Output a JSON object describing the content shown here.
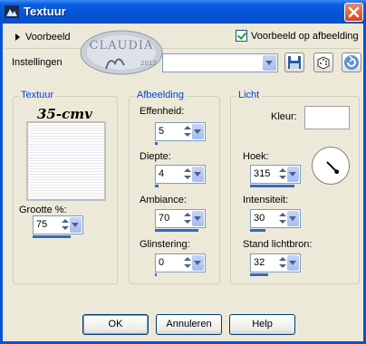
{
  "window": {
    "title": "Textuur",
    "close_icon": "close-icon"
  },
  "preview": {
    "label": "Voorbeeld",
    "checkbox_label": "Voorbeeld op afbeelding",
    "checked": true
  },
  "logo": {
    "text": "CLAUDIA",
    "year": "2012"
  },
  "settings": {
    "label": "Instellingen",
    "value": "",
    "icons": [
      "save-icon",
      "randomize-dice-icon",
      "reset-icon"
    ]
  },
  "texture": {
    "group_title": "Textuur",
    "name": "35-cmv",
    "size_label": "Grootte %:",
    "size_value": "75",
    "size_fraction": 0.75
  },
  "image": {
    "group_title": "Afbeelding",
    "smoothness_label": "Effenheid:",
    "smoothness_value": "5",
    "smoothness_fraction": 0.05,
    "depth_label": "Diepte:",
    "depth_value": "4",
    "depth_fraction": 0.08,
    "ambience_label": "Ambiance:",
    "ambience_value": "70",
    "ambience_fraction": 0.85,
    "shine_label": "Glinstering:",
    "shine_value": "0",
    "shine_fraction": 0
  },
  "light": {
    "group_title": "Licht",
    "color_label": "Kleur:",
    "color": "#FFFFFF",
    "angle_label": "Hoek:",
    "angle_value": "315",
    "angle_fraction": 0.875,
    "intensity_label": "Intensiteit:",
    "intensity_value": "30",
    "intensity_fraction": 0.3,
    "elevation_label": "Stand lichtbron:",
    "elevation_value": "32",
    "elevation_fraction": 0.36
  },
  "buttons": {
    "ok": "OK",
    "cancel": "Annuleren",
    "help": "Help"
  },
  "colors": {
    "title_bar": "#0553D6",
    "accent_blue": "#0046D5",
    "progress": "#316AC5",
    "dialog_bg": "#ECE9D8"
  }
}
